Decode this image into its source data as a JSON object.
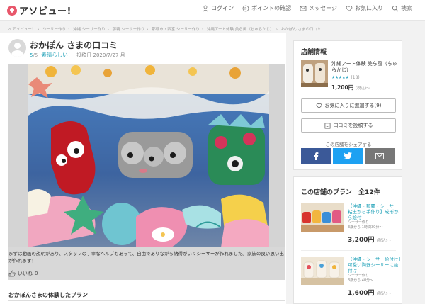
{
  "header": {
    "logo": "アソビュー!",
    "nav": [
      {
        "label": "ログイン",
        "icon": "person-icon"
      },
      {
        "label": "ポイントの確認",
        "icon": "point-icon"
      },
      {
        "label": "メッセージ",
        "icon": "mail-icon"
      },
      {
        "label": "お気に入り",
        "icon": "heart-icon"
      },
      {
        "label": "検索",
        "icon": "search-icon"
      }
    ]
  },
  "breadcrumb": [
    "アソビュー！",
    "シーサー作り",
    "沖縄 シーサー作り",
    "那覇 シーサー作り",
    "那覇市・西宮 シーサー作り",
    "沖縄アート体験 美ら風（ちゅらかじ）",
    "おかぽん さまの口コミ"
  ],
  "review": {
    "title": "おかぽん さまの口コミ",
    "score": "5",
    "score_denom": "/5",
    "verdict": "素晴らしい！",
    "posted": "投稿日 2020/7/27 月",
    "comment": "まずは動画の説明があり、スタッフの丁寧なヘルプもあって、自由でありながら納得がいくシーサーが作れました。家族の良い思い出が作れます！",
    "like_label": "いいね",
    "like_count": "0",
    "plans_heading": "おかぽんさまの体験したプラン"
  },
  "shop": {
    "heading": "店舗情報",
    "name": "沖縄アート体験 美ら風（ちゅらかじ）",
    "stars": "★★★★★",
    "review_count": "(18)",
    "price": "1,200円",
    "price_note": "(税込)～",
    "favorite_label": "お気に入りに追加する(9)",
    "post_review_label": "口コミを投稿する",
    "share_label": "この店舗をシェアする"
  },
  "plans": {
    "heading": "この店舗のプラン　全12件",
    "items": [
      {
        "title": "【沖縄・那覇・シーサー粘土から手作り】成形から絵付",
        "category": "シーサー作り",
        "meta": "3歳から 1時間30分～",
        "price": "3,200円",
        "price_note": "(税込)～"
      },
      {
        "title": "【沖縄・シーサー絵付け】可愛い陶器シーサーに絵付け",
        "category": "シーサー作り",
        "meta": "3歳から 40分～",
        "price": "1,600円",
        "price_note": "(税込)～"
      }
    ]
  },
  "colors": {
    "accent": "#22a2b8",
    "logo": "#e8576b",
    "facebook": "#3b5998",
    "twitter": "#1da1f2",
    "mail": "#777777"
  }
}
